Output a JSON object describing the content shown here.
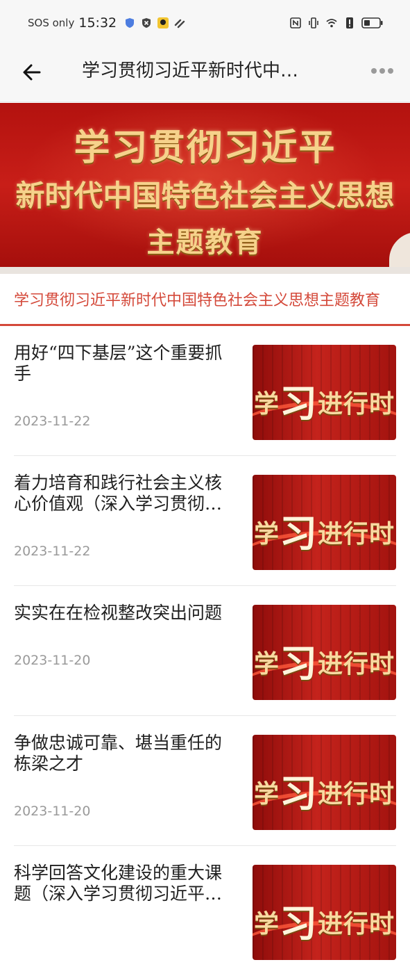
{
  "status_bar": {
    "carrier": "SOS only",
    "time": "15:32",
    "left_icons": [
      "shield-icon",
      "app-icon",
      "notification-icon",
      "app-icon",
      "link-icon"
    ],
    "right_icons": [
      "nfc-icon",
      "vibrate-icon",
      "wifi-icon",
      "alert-icon",
      "battery-icon"
    ]
  },
  "nav": {
    "title": "学习贯彻习近平新时代中…"
  },
  "banner": {
    "line1": "学习贯彻习近平",
    "line2": "新时代中国特色社会主义思想",
    "line3": "主题教育"
  },
  "section": {
    "title": "学习贯彻习近平新时代中国特色社会主义思想主题教育"
  },
  "thumbnail": {
    "prefix": "学",
    "big_char": "习",
    "suffix": "进行时"
  },
  "articles": [
    {
      "title": "用好“四下基层”这个重要抓手",
      "date": "2023-11-22"
    },
    {
      "title": "着力培育和践行社会主义核心价值观（深入学习贯彻…",
      "date": "2023-11-22"
    },
    {
      "title": "实实在在检视整改突出问题",
      "date": "2023-11-20"
    },
    {
      "title": "争做忠诚可靠、堪当重任的栋梁之才",
      "date": "2023-11-20"
    },
    {
      "title": "科学回答文化建设的重大课题（深入学习贯彻习近平…",
      "date": ""
    }
  ],
  "colors": {
    "accent": "#d4493a",
    "banner_red": "#c81e18",
    "gold": "#f6d28b"
  }
}
